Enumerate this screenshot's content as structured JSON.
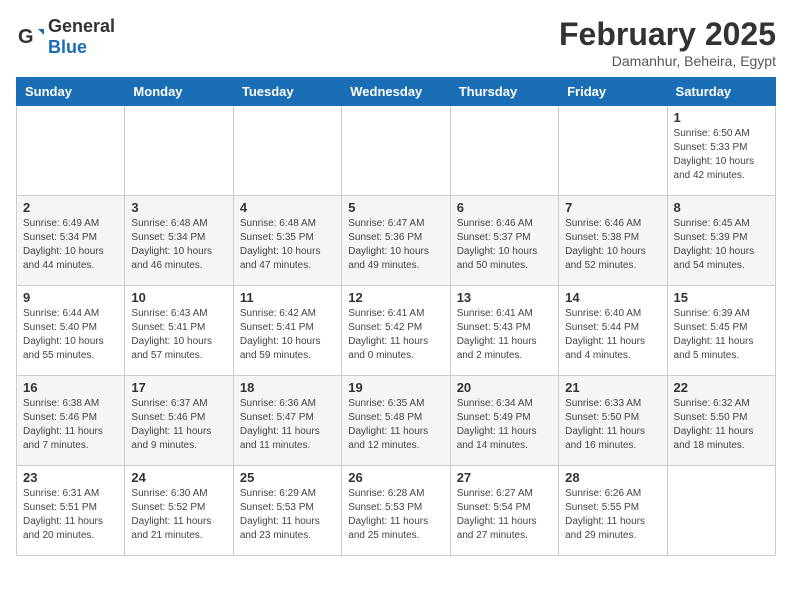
{
  "header": {
    "logo_general": "General",
    "logo_blue": "Blue",
    "title": "February 2025",
    "subtitle": "Damanhur, Beheira, Egypt"
  },
  "days_of_week": [
    "Sunday",
    "Monday",
    "Tuesday",
    "Wednesday",
    "Thursday",
    "Friday",
    "Saturday"
  ],
  "weeks": [
    [
      {
        "day": "",
        "info": ""
      },
      {
        "day": "",
        "info": ""
      },
      {
        "day": "",
        "info": ""
      },
      {
        "day": "",
        "info": ""
      },
      {
        "day": "",
        "info": ""
      },
      {
        "day": "",
        "info": ""
      },
      {
        "day": "1",
        "info": "Sunrise: 6:50 AM\nSunset: 5:33 PM\nDaylight: 10 hours and 42 minutes."
      }
    ],
    [
      {
        "day": "2",
        "info": "Sunrise: 6:49 AM\nSunset: 5:34 PM\nDaylight: 10 hours and 44 minutes."
      },
      {
        "day": "3",
        "info": "Sunrise: 6:48 AM\nSunset: 5:34 PM\nDaylight: 10 hours and 46 minutes."
      },
      {
        "day": "4",
        "info": "Sunrise: 6:48 AM\nSunset: 5:35 PM\nDaylight: 10 hours and 47 minutes."
      },
      {
        "day": "5",
        "info": "Sunrise: 6:47 AM\nSunset: 5:36 PM\nDaylight: 10 hours and 49 minutes."
      },
      {
        "day": "6",
        "info": "Sunrise: 6:46 AM\nSunset: 5:37 PM\nDaylight: 10 hours and 50 minutes."
      },
      {
        "day": "7",
        "info": "Sunrise: 6:46 AM\nSunset: 5:38 PM\nDaylight: 10 hours and 52 minutes."
      },
      {
        "day": "8",
        "info": "Sunrise: 6:45 AM\nSunset: 5:39 PM\nDaylight: 10 hours and 54 minutes."
      }
    ],
    [
      {
        "day": "9",
        "info": "Sunrise: 6:44 AM\nSunset: 5:40 PM\nDaylight: 10 hours and 55 minutes."
      },
      {
        "day": "10",
        "info": "Sunrise: 6:43 AM\nSunset: 5:41 PM\nDaylight: 10 hours and 57 minutes."
      },
      {
        "day": "11",
        "info": "Sunrise: 6:42 AM\nSunset: 5:41 PM\nDaylight: 10 hours and 59 minutes."
      },
      {
        "day": "12",
        "info": "Sunrise: 6:41 AM\nSunset: 5:42 PM\nDaylight: 11 hours and 0 minutes."
      },
      {
        "day": "13",
        "info": "Sunrise: 6:41 AM\nSunset: 5:43 PM\nDaylight: 11 hours and 2 minutes."
      },
      {
        "day": "14",
        "info": "Sunrise: 6:40 AM\nSunset: 5:44 PM\nDaylight: 11 hours and 4 minutes."
      },
      {
        "day": "15",
        "info": "Sunrise: 6:39 AM\nSunset: 5:45 PM\nDaylight: 11 hours and 5 minutes."
      }
    ],
    [
      {
        "day": "16",
        "info": "Sunrise: 6:38 AM\nSunset: 5:46 PM\nDaylight: 11 hours and 7 minutes."
      },
      {
        "day": "17",
        "info": "Sunrise: 6:37 AM\nSunset: 5:46 PM\nDaylight: 11 hours and 9 minutes."
      },
      {
        "day": "18",
        "info": "Sunrise: 6:36 AM\nSunset: 5:47 PM\nDaylight: 11 hours and 11 minutes."
      },
      {
        "day": "19",
        "info": "Sunrise: 6:35 AM\nSunset: 5:48 PM\nDaylight: 11 hours and 12 minutes."
      },
      {
        "day": "20",
        "info": "Sunrise: 6:34 AM\nSunset: 5:49 PM\nDaylight: 11 hours and 14 minutes."
      },
      {
        "day": "21",
        "info": "Sunrise: 6:33 AM\nSunset: 5:50 PM\nDaylight: 11 hours and 16 minutes."
      },
      {
        "day": "22",
        "info": "Sunrise: 6:32 AM\nSunset: 5:50 PM\nDaylight: 11 hours and 18 minutes."
      }
    ],
    [
      {
        "day": "23",
        "info": "Sunrise: 6:31 AM\nSunset: 5:51 PM\nDaylight: 11 hours and 20 minutes."
      },
      {
        "day": "24",
        "info": "Sunrise: 6:30 AM\nSunset: 5:52 PM\nDaylight: 11 hours and 21 minutes."
      },
      {
        "day": "25",
        "info": "Sunrise: 6:29 AM\nSunset: 5:53 PM\nDaylight: 11 hours and 23 minutes."
      },
      {
        "day": "26",
        "info": "Sunrise: 6:28 AM\nSunset: 5:53 PM\nDaylight: 11 hours and 25 minutes."
      },
      {
        "day": "27",
        "info": "Sunrise: 6:27 AM\nSunset: 5:54 PM\nDaylight: 11 hours and 27 minutes."
      },
      {
        "day": "28",
        "info": "Sunrise: 6:26 AM\nSunset: 5:55 PM\nDaylight: 11 hours and 29 minutes."
      },
      {
        "day": "",
        "info": ""
      }
    ]
  ]
}
